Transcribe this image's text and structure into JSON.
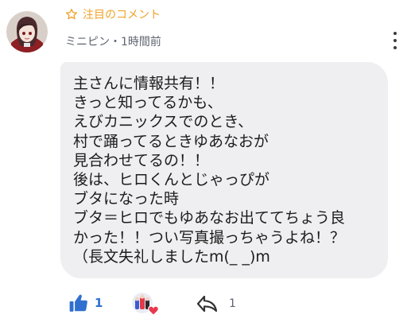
{
  "comment": {
    "featured_label": "注目のコメント",
    "meta": "ミニピン・1時間前",
    "body": "主さんに情報共有！！\nきっと知ってるかも、\nえびカニックスでのとき、\n村で踊ってるときゆあなおが\n見合わせてるの！！\n後は、ヒロくんとじゃっぴが\nブタになった時\nブタ＝ヒロでもゆあなお出ててちょう良\nかった！！つい写真撮っちゃうよね！？\n（長文失礼しましたm(_ _)m"
  },
  "actions": {
    "like_count": "1",
    "reply_count": "1"
  },
  "colors": {
    "accent": "#f0a32a",
    "like_blue": "#2f6fd0",
    "bubble_bg": "#efeff1",
    "heart": "#e8384f"
  },
  "icons": {
    "featured": "star-outline-icon",
    "more": "more-vertical-icon",
    "like": "thumbs-up-icon",
    "reply": "reply-arrow-icon",
    "liker_badge": "heart-icon"
  }
}
